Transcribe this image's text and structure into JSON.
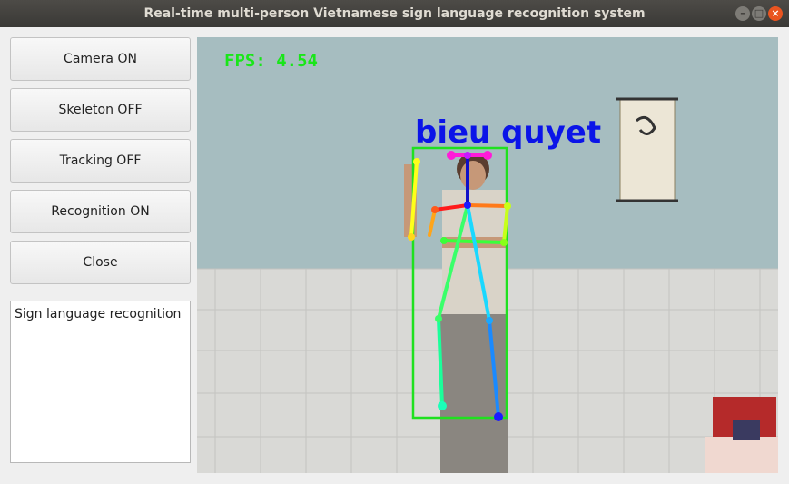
{
  "window": {
    "title": "Real-time multi-person Vietnamese sign language recognition system",
    "buttons": [
      "minimize",
      "maximize",
      "close"
    ]
  },
  "controls": {
    "camera_label": "Camera ON",
    "skeleton_label": "Skeleton OFF",
    "tracking_label": "Tracking OFF",
    "recognition_label": "Recognition ON",
    "close_label": "Close"
  },
  "log": {
    "text": "Sign language recognition"
  },
  "video": {
    "fps_text": "FPS: 4.54",
    "recognized_text": "bieu quyet",
    "colors": {
      "fps": "#19e619",
      "label": "#0b14e8",
      "box": "#1fe11f"
    }
  },
  "icons": {
    "minimize": "minimize-icon",
    "maximize": "maximize-icon",
    "close": "close-icon"
  }
}
